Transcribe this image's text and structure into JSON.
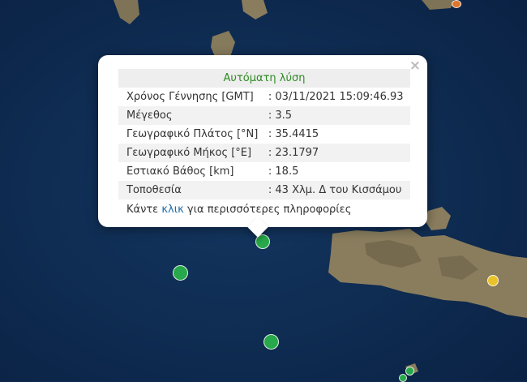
{
  "popup": {
    "title": "Αυτόματη λύση",
    "close_label": "×",
    "rows": [
      {
        "label": "Χρόνος Γέννησης [GMT]",
        "value": ": 03/11/2021 15:09:46.93"
      },
      {
        "label": "Μέγεθος",
        "value": ": 3.5"
      },
      {
        "label": "Γεωγραφικό Πλάτος [°N]",
        "value": ": 35.4415"
      },
      {
        "label": "Γεωγραφικό Μήκος [°E]",
        "value": ": 23.1797"
      },
      {
        "label": "Εστιακό Βάθος [km]",
        "value": ": 18.5"
      },
      {
        "label": "Τοποθεσία",
        "value": ": 43 Χλμ. Δ του Κισσάμου"
      }
    ],
    "more_prefix": "Κάντε ",
    "more_link": "κλικ",
    "more_suffix": " για περισσότερες πληροφορίες"
  },
  "map": {
    "sea_color": "#0d2a4f",
    "land_color": "#8a7d5e",
    "markers": [
      {
        "color": "green"
      },
      {
        "color": "green"
      },
      {
        "color": "green"
      },
      {
        "color": "green"
      },
      {
        "color": "green"
      },
      {
        "color": "yellow"
      },
      {
        "color": "orange"
      }
    ]
  }
}
